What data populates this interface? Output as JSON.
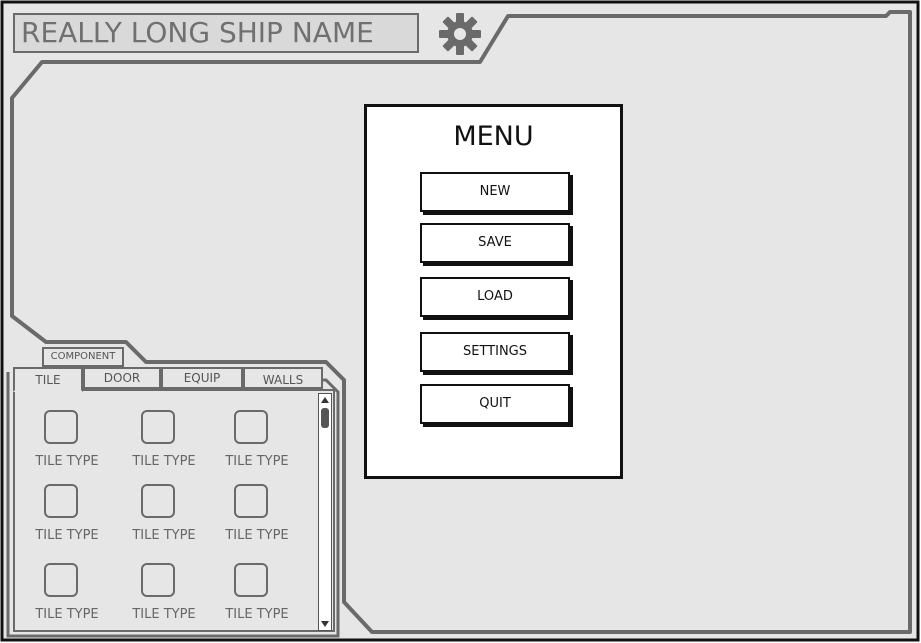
{
  "header": {
    "ship_name": "REALLY LONG SHIP NAME",
    "settings_icon": "gear-icon"
  },
  "menu": {
    "title": "MENU",
    "buttons": [
      "NEW",
      "SAVE",
      "LOAD",
      "SETTINGS",
      "QUIT"
    ]
  },
  "component_panel": {
    "group_tab": "COMPONENT",
    "tabs": [
      "TILE",
      "DOOR",
      "EQUIP",
      "WALLS"
    ],
    "active_tab": "TILE",
    "items": [
      "TILE TYPE",
      "TILE TYPE",
      "TILE TYPE",
      "TILE TYPE",
      "TILE TYPE",
      "TILE TYPE",
      "TILE TYPE",
      "TILE TYPE",
      "TILE TYPE"
    ]
  },
  "colors": {
    "frame_fill": "#e6e6e6",
    "frame_stroke": "#6a6a6a",
    "outer_border": "#111111"
  }
}
